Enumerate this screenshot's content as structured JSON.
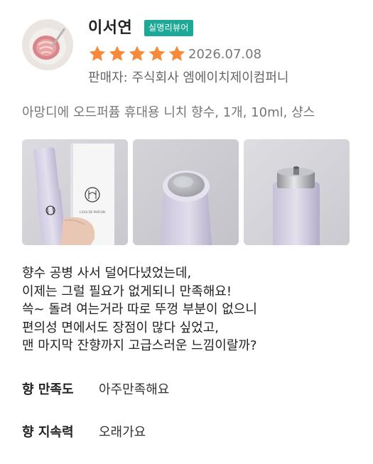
{
  "reviewer": {
    "name": "이서연",
    "badge": "실명리뷰어",
    "rating": 5,
    "date": "2026.07.08",
    "seller": "판매자: 주식회사 엠에이치제이컴퍼니"
  },
  "product_option": "아망디에 오드퍼퓸 휴대용 니치 향수, 1개, 10ml, 샹스",
  "photos": [
    {
      "name": "perfume-with-box-photo",
      "box_text": "L'EAU DE PARFUM"
    },
    {
      "name": "perfume-cap-top-photo"
    },
    {
      "name": "perfume-atomizer-nozzle-photo"
    }
  ],
  "review_text": [
    "향수 공병 사서 덜어다녔었는데,",
    "이제는 그럴 필요가 없게되니 만족해요!",
    "쓱~ 돌려 여는거라 따로 뚜껑 부분이 없으니",
    "편의성 면에서도 장점이 많다 싶었고,",
    "맨 마지막 잔향까지 고급스러운 느낌이랄까?"
  ],
  "survey": [
    {
      "label": "향 만족도",
      "value": "아주만족해요"
    },
    {
      "label": "향 지속력",
      "value": "오래가요"
    }
  ],
  "colors": {
    "star": "#f9893a",
    "badge": "#1ea896",
    "bottle": "#d9d4e6"
  }
}
